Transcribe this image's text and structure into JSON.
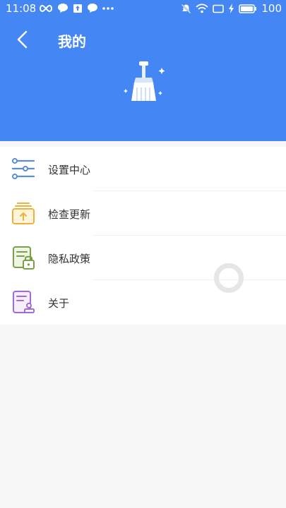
{
  "statusbar": {
    "time": "11:08",
    "battery": "100",
    "left_icons": [
      "infinity-icon",
      "chat-bubble-icon",
      "upload-box-icon",
      "chat-bubble-icon",
      "more-dots-icon"
    ],
    "right_icons": [
      "bell-muted-icon",
      "wifi-icon",
      "screen-icon",
      "charging-bolt-icon",
      "battery-icon"
    ]
  },
  "header": {
    "title": "我的",
    "back_icon": "chevron-left-icon",
    "hero_icon": "broom-sparkle-icon",
    "background": "#4486f4"
  },
  "menu": {
    "items": [
      {
        "label": "设置中心",
        "icon": "settings-sliders-icon",
        "color": "#5a8fd8"
      },
      {
        "label": "检查更新",
        "icon": "update-box-icon",
        "color": "#f0b13a"
      },
      {
        "label": "隐私政策",
        "icon": "privacy-lock-icon",
        "color": "#7aa04a"
      },
      {
        "label": "关于",
        "icon": "about-document-icon",
        "color": "#a46ad8"
      }
    ]
  }
}
